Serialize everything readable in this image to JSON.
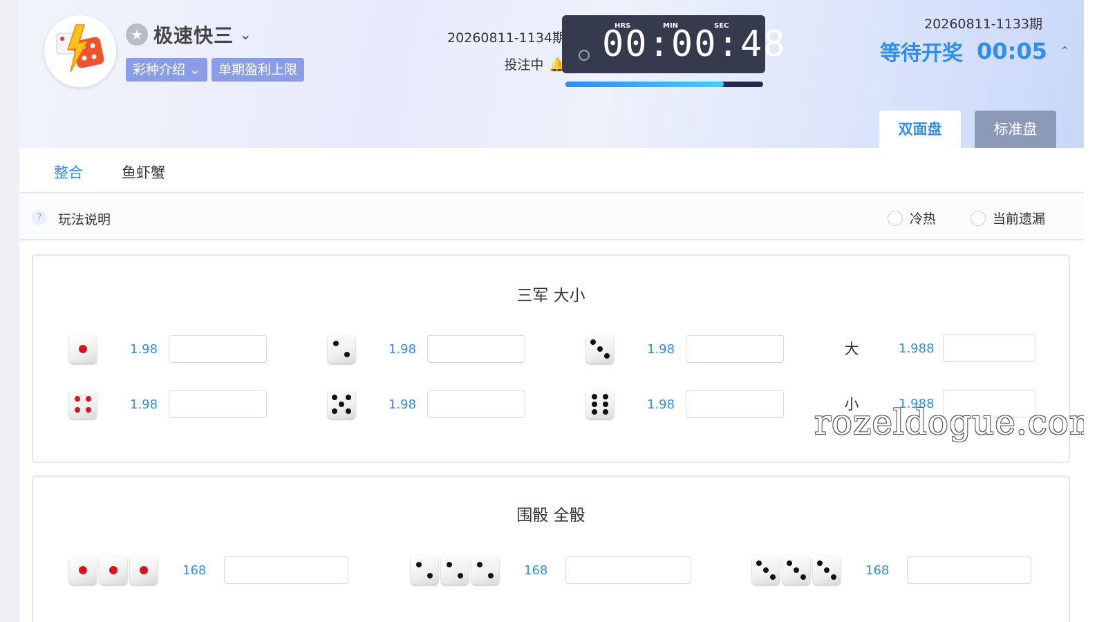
{
  "header": {
    "game_title": "极速快三",
    "pills": [
      "彩种介绍",
      "单期盈利上限"
    ],
    "next_issue": "20260811-1134期",
    "status": "投注中",
    "countdown": {
      "labels": [
        "HRS",
        "MIN",
        "SEC"
      ],
      "time": "00:00:48",
      "progress_fraction": 0.8
    },
    "last_issue": "20260811-1133期",
    "wait_label": "等待开奖",
    "wait_time": "00:05",
    "plate_tabs": [
      {
        "label": "双面盘",
        "active": true
      },
      {
        "label": "标准盘",
        "active": false
      }
    ]
  },
  "subtabs": [
    {
      "label": "整合",
      "active": true
    },
    {
      "label": "鱼虾蟹",
      "active": false
    }
  ],
  "infobar": {
    "help_text": "玩法说明",
    "options": [
      "冷热",
      "当前遗漏"
    ]
  },
  "section1": {
    "title": "三军 大小",
    "items": [
      {
        "die": 1,
        "odds": "1.98"
      },
      {
        "die": 2,
        "odds": "1.98"
      },
      {
        "die": 3,
        "odds": "1.98"
      },
      {
        "label": "大",
        "odds": "1.988"
      },
      {
        "die": 4,
        "odds": "1.98"
      },
      {
        "die": 5,
        "odds": "1.98"
      },
      {
        "die": 6,
        "odds": "1.98"
      },
      {
        "label": "小",
        "odds": "1.988"
      }
    ]
  },
  "section2": {
    "title": "围骰 全骰",
    "items": [
      {
        "dice": [
          1,
          1,
          1
        ],
        "odds": "168"
      },
      {
        "dice": [
          2,
          2,
          2
        ],
        "odds": "168"
      },
      {
        "dice": [
          3,
          3,
          3
        ],
        "odds": "168"
      }
    ]
  },
  "watermark": "rozeldogue.com",
  "colors": {
    "accent": "#2f8cf0",
    "pill": "#8b9de6",
    "countdown_bg": "#363a4d",
    "tab_inactive": "#8c9ab7"
  }
}
